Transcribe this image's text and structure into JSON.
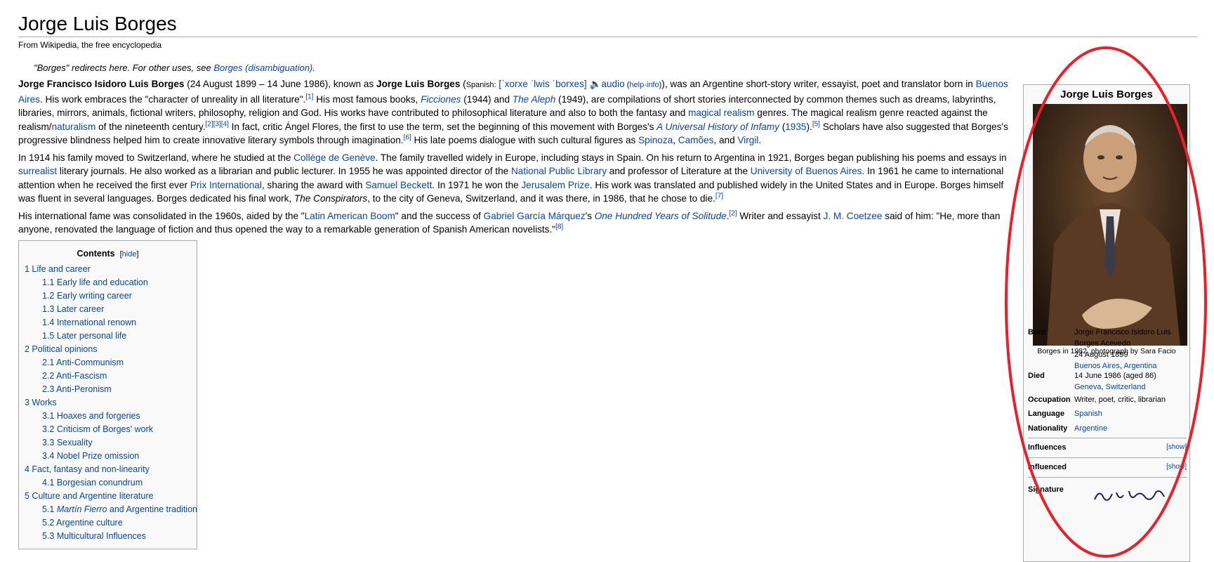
{
  "page": {
    "title": "Jorge Luis Borges",
    "tagline": "From Wikipedia, the free encyclopedia",
    "hatnote_prefix": "\"Borges\" redirects here. For other uses, see ",
    "hatnote_link": "Borges (disambiguation)",
    "hatnote_suffix": "."
  },
  "p1": {
    "name_full": "Jorge Francisco Isidoro Luis Borges",
    "t1": " (24 August 1899 – 14 June 1986), known as ",
    "name_short": "Jorge Luis Borges",
    "t2": " (",
    "spanish_label": "Spanish:",
    "ipa": "[ˈxorxe ˈlwis ˈborxes]",
    "audio": "audio",
    "help_open": " (",
    "help": "help",
    "dot": "·",
    "info": "info",
    "help_close": ")",
    "t3": "), was an Argentine short-story writer, essayist, poet and translator born in ",
    "link_ba": "Buenos Aires",
    "t4": ". His work embraces the \"character of unreality in all literature\".",
    "ref1": "[1]",
    "t5": " His most famous books, ",
    "ficciones": "Ficciones",
    "t6": " (1944) and ",
    "aleph": "The Aleph",
    "t7": " (1949), are compilations of short stories interconnected by common themes such as dreams, labyrinths, libraries, mirrors, animals, fictional writers, philosophy, religion and God. His works have contributed to philosophical literature and also to both the fantasy and ",
    "magical_realism": "magical realism",
    "t8": " genres. The magical realism genre reacted against the realism/",
    "naturalism": "naturalism",
    "t9": " of the nineteenth century.",
    "refs234": "[2][3][4]",
    "t10": " In fact, critic Ángel Flores, the first to use the term, set the beginning of this movement with Borges's ",
    "universal_history": "A Universal History of Infamy",
    "t11": " (",
    "y1935": "1935",
    "t12": ").",
    "ref5": "[5]",
    "t13": " Scholars have also suggested that Borges's progressive blindness helped him to create innovative literary symbols through imagination.",
    "ref6": "[6]",
    "t14": " His late poems dialogue with such cultural figures as ",
    "spinoza": "Spinoza",
    "t15": ", ",
    "camoes": "Camões",
    "t16": ", and ",
    "virgil": "Virgil",
    "t17": "."
  },
  "p2": {
    "t1": "In 1914 his family moved to Switzerland, where he studied at the ",
    "college": "Collège de Genève",
    "t2": ". The family travelled widely in Europe, including stays in Spain. On his return to Argentina in 1921, Borges began publishing his poems and essays in ",
    "surrealist": "surrealist",
    "t3": " literary journals. He also worked as a librarian and public lecturer. In 1955 he was appointed director of the ",
    "npl": "National Public Library",
    "t4": " and professor of Literature at the ",
    "uba": "University of Buenos Aires",
    "t5": ". In 1961 he came to international attention when he received the first ever ",
    "prix": "Prix International",
    "t6": ", sharing the award with ",
    "beckett": "Samuel Beckett",
    "t7": ". In 1971 he won the ",
    "jerusalem": "Jerusalem Prize",
    "t8": ". His work was translated and published widely in the United States and in Europe. Borges himself was fluent in several languages. Borges dedicated his final work, ",
    "conspirators": "The Conspirators",
    "t9": ", to the city of Geneva, Switzerland, and it was there, in 1986, that he chose to die.",
    "ref7": "[7]"
  },
  "p3": {
    "t1": "His international fame was consolidated in the 1960s, aided by the \"",
    "boom": "Latin American Boom",
    "t2": "\" and the success of ",
    "marquez": "Gabriel García Márquez",
    "t3": "'s ",
    "solitude": "One Hundred Years of Solitude",
    "t4": ".",
    "ref2": "[2]",
    "t5": " Writer and essayist ",
    "coetzee": "J. M. Coetzee",
    "t6": " said of him: \"He, more than anyone, renovated the language of fiction and thus opened the way to a remarkable generation of Spanish American novelists.\"",
    "ref8": "[8]"
  },
  "toc": {
    "title": "Contents",
    "hide_open": "[",
    "hide": "hide",
    "hide_close": "]",
    "items": [
      {
        "level": 1,
        "label": "1 Life and career"
      },
      {
        "level": 2,
        "label": "1.1 Early life and education"
      },
      {
        "level": 2,
        "label": "1.2 Early writing career"
      },
      {
        "level": 2,
        "label": "1.3 Later career"
      },
      {
        "level": 2,
        "label": "1.4 International renown"
      },
      {
        "level": 2,
        "label": "1.5 Later personal life"
      },
      {
        "level": 1,
        "label": "2 Political opinions"
      },
      {
        "level": 2,
        "label": "2.1 Anti-Communism"
      },
      {
        "level": 2,
        "label": "2.2 Anti-Fascism"
      },
      {
        "level": 2,
        "label": "2.3 Anti-Peronism"
      },
      {
        "level": 1,
        "label": "3 Works"
      },
      {
        "level": 2,
        "label": "3.1 Hoaxes and forgeries"
      },
      {
        "level": 2,
        "label": "3.2 Criticism of Borges' work"
      },
      {
        "level": 2,
        "label": "3.3 Sexuality"
      },
      {
        "level": 2,
        "label": "3.4 Nobel Prize omission"
      },
      {
        "level": 1,
        "label": "4 Fact, fantasy and non-linearity"
      },
      {
        "level": 2,
        "label": "4.1 Borgesian conundrum"
      },
      {
        "level": 1,
        "label": "5 Culture and Argentine literature"
      },
      {
        "level": 2,
        "label_italic": "Martín Fierro",
        "label_prefix": "5.1 ",
        "label_suffix": " and Argentine tradition"
      },
      {
        "level": 2,
        "label": "5.2 Argentine culture"
      },
      {
        "level": 2,
        "label": "5.3 Multicultural Influences"
      }
    ]
  },
  "infobox": {
    "title": "Jorge Luis Borges",
    "caption": "Borges in 1982, photograph by Sara Facio",
    "born_label": "Born",
    "born_line1": "Jorge Francisco Isidoro Luis",
    "born_line2": "Borges Acevedo",
    "born_line3": "24 August 1899",
    "born_place": "Buenos Aires",
    "born_sep": ", ",
    "born_country": "Argentina",
    "died_label": "Died",
    "died_line1": "14 June 1986 (aged 86)",
    "died_place": "Geneva",
    "died_sep": ", ",
    "died_country": "Switzerland",
    "occupation_label": "Occupation",
    "occupation": "Writer, poet, critic, librarian",
    "language_label": "Language",
    "language": "Spanish",
    "nationality_label": "Nationality",
    "nationality": "Argentine",
    "influences_label": "Influences",
    "influenced_label": "Influenced",
    "show": "[show]",
    "signature_label": "Signature"
  },
  "colors": {
    "link": "#0645ad",
    "annotation": "#e8202a",
    "infobox_bg": "#f9f9f9",
    "border": "#aaaaaa"
  }
}
